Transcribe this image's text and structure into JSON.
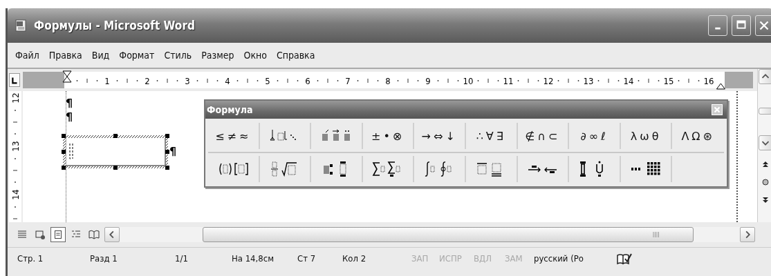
{
  "window": {
    "title": "Формулы - Microsoft Word"
  },
  "menu": [
    {
      "label": "Файл"
    },
    {
      "label": "Правка"
    },
    {
      "label": "Вид"
    },
    {
      "label": "Формат"
    },
    {
      "label": "Стиль"
    },
    {
      "label": "Размер"
    },
    {
      "label": "Окно"
    },
    {
      "label": "Справка"
    }
  ],
  "ruler": {
    "numbers": [
      "1",
      "2",
      "3",
      "4",
      "5",
      "6",
      "7",
      "8",
      "9",
      "10",
      "11",
      "12",
      "13",
      "14",
      "15",
      "16"
    ],
    "vertical_numbers": [
      "12",
      "13",
      "14"
    ]
  },
  "document": {
    "paragraph_marks": [
      "¶",
      "¶",
      "¶"
    ]
  },
  "formula_palette": {
    "title": "Формула",
    "rows": [
      [
        {
          "kind": "symbols",
          "text": "≤≠≈"
        },
        {
          "kind": "spaces"
        },
        {
          "kind": "embellishments"
        },
        {
          "kind": "symbols",
          "text": "±•⊗"
        },
        {
          "kind": "symbols",
          "text": "→⇔↓"
        },
        {
          "kind": "symbols",
          "text": "∴∀∃"
        },
        {
          "kind": "symbols",
          "text": "∉∩⊂"
        },
        {
          "kind": "symbols",
          "text": "∂∞ℓ"
        },
        {
          "kind": "symbols",
          "text": "λωθ"
        },
        {
          "kind": "symbols",
          "text": "ΛΩ⊛"
        }
      ],
      [
        {
          "kind": "fences"
        },
        {
          "kind": "fraction"
        },
        {
          "kind": "script"
        },
        {
          "kind": "sum"
        },
        {
          "kind": "integral"
        },
        {
          "kind": "bars"
        },
        {
          "kind": "arrows"
        },
        {
          "kind": "products"
        },
        {
          "kind": "matrix"
        }
      ]
    ]
  },
  "view_buttons": [
    {
      "kind": "normal",
      "selected": false
    },
    {
      "kind": "web",
      "selected": false
    },
    {
      "kind": "print",
      "selected": true
    },
    {
      "kind": "outline",
      "selected": false
    },
    {
      "kind": "reading",
      "selected": false
    }
  ],
  "status_bar": [
    {
      "text": "Стр. 1",
      "disabled": false
    },
    {
      "text": "Разд 1",
      "disabled": false
    },
    {
      "text": "1/1",
      "disabled": false
    },
    {
      "text": "На 14,8см",
      "disabled": false
    },
    {
      "text": "Ст 7",
      "disabled": false
    },
    {
      "text": "Кол 2",
      "disabled": false
    },
    {
      "text": "ЗАП",
      "disabled": true
    },
    {
      "text": "ИСПР",
      "disabled": true
    },
    {
      "text": "ВДЛ",
      "disabled": true
    },
    {
      "text": "ЗАМ",
      "disabled": true
    },
    {
      "text": "русский (Ро",
      "disabled": false
    }
  ]
}
